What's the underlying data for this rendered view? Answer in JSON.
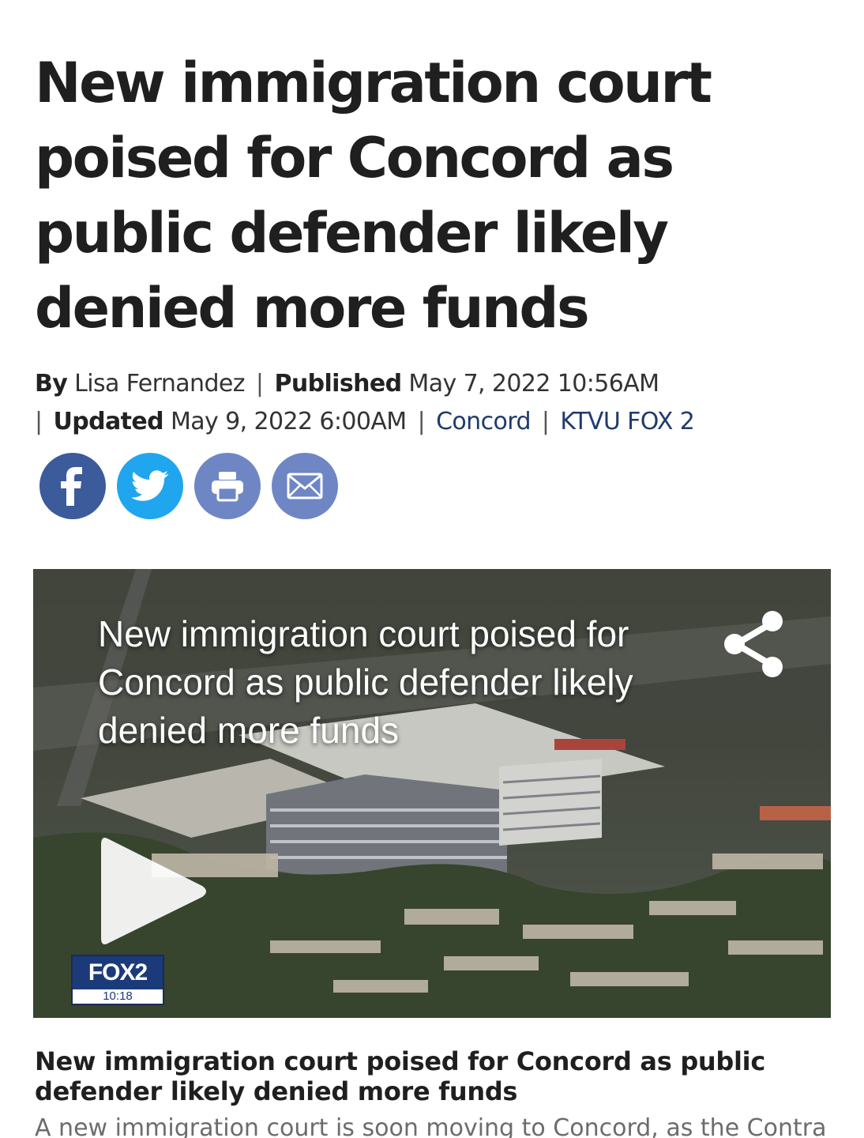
{
  "article": {
    "headline": "New immigration court poised for Concord as public defender likely denied more funds",
    "byline": {
      "by_label": "By",
      "author": "Lisa Fernandez",
      "published_label": "Published",
      "published_date": "May 7, 2022 10:56AM",
      "updated_label": "Updated",
      "updated_date": "May 9, 2022 6:00AM",
      "separator": "|",
      "category": "Concord",
      "source": "KTVU FOX 2"
    },
    "share_buttons": [
      {
        "name": "facebook",
        "icon": "facebook-icon",
        "color": "#3b5b9b"
      },
      {
        "name": "twitter",
        "icon": "twitter-bird-icon",
        "color": "#20a6ee"
      },
      {
        "name": "print",
        "icon": "printer-icon",
        "color": "#6f86c4"
      },
      {
        "name": "email",
        "icon": "envelope-icon",
        "color": "#6f86c4"
      }
    ],
    "video": {
      "overlay_title": "New immigration court poised for Concord as public defender likely denied more funds",
      "logo": "FOX2",
      "duration": "10:18"
    },
    "caption": "New immigration court poised for Concord as public defender likely denied more funds",
    "lede": "A new immigration court is soon moving to Concord, as the Contra"
  }
}
